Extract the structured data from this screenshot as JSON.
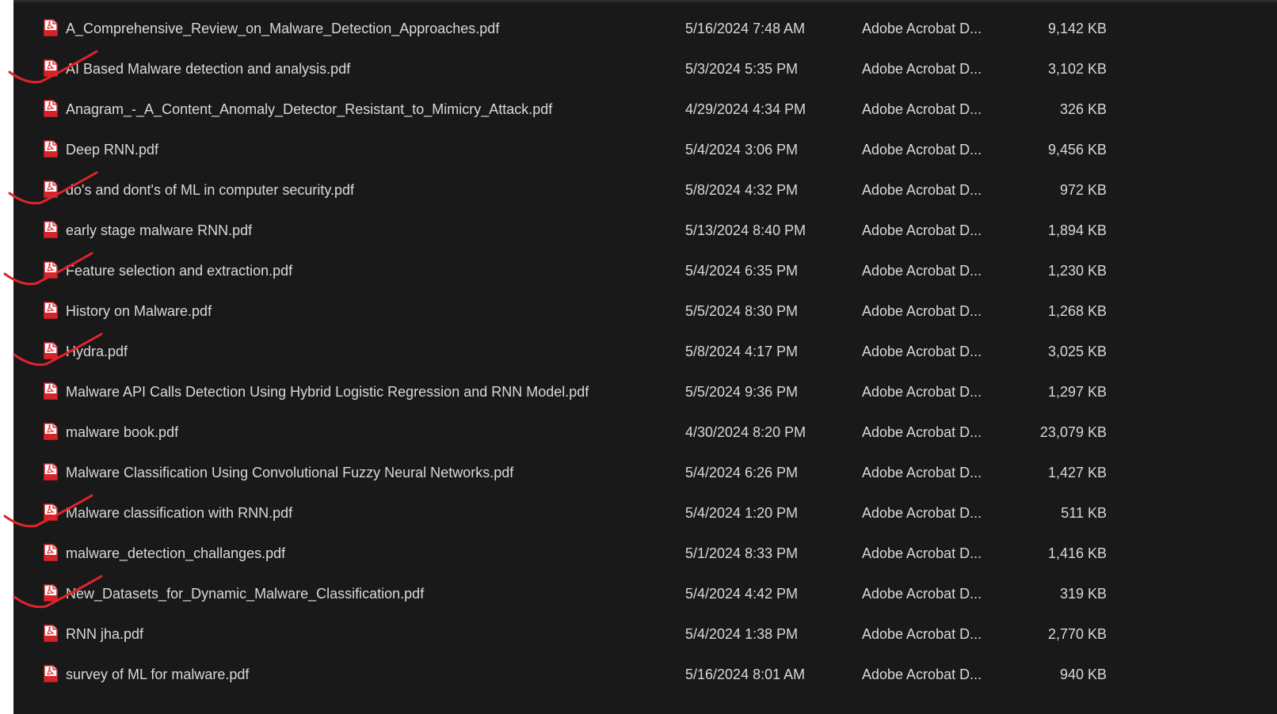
{
  "pdf_icon": "pdf-file-icon",
  "annotation_color": "#e0242b",
  "files": [
    {
      "name": "A_Comprehensive_Review_on_Malware_Detection_Approaches.pdf",
      "date": "5/16/2024 7:48 AM",
      "type": "Adobe Acrobat D...",
      "size": "9,142 KB",
      "checked": false
    },
    {
      "name": "AI Based Malware detection and analysis.pdf",
      "date": "5/3/2024 5:35 PM",
      "type": "Adobe Acrobat D...",
      "size": "3,102 KB",
      "checked": true
    },
    {
      "name": "Anagram_-_A_Content_Anomaly_Detector_Resistant_to_Mimicry_Attack.pdf",
      "date": "4/29/2024 4:34 PM",
      "type": "Adobe Acrobat D...",
      "size": "326 KB",
      "checked": false
    },
    {
      "name": "Deep RNN.pdf",
      "date": "5/4/2024 3:06 PM",
      "type": "Adobe Acrobat D...",
      "size": "9,456 KB",
      "checked": false
    },
    {
      "name": "do's and dont's of ML in computer security.pdf",
      "date": "5/8/2024 4:32 PM",
      "type": "Adobe Acrobat D...",
      "size": "972 KB",
      "checked": true
    },
    {
      "name": "early stage malware RNN.pdf",
      "date": "5/13/2024 8:40 PM",
      "type": "Adobe Acrobat D...",
      "size": "1,894 KB",
      "checked": false
    },
    {
      "name": "Feature selection and extraction.pdf",
      "date": "5/4/2024 6:35 PM",
      "type": "Adobe Acrobat D...",
      "size": "1,230 KB",
      "checked": true
    },
    {
      "name": "History on Malware.pdf",
      "date": "5/5/2024 8:30 PM",
      "type": "Adobe Acrobat D...",
      "size": "1,268 KB",
      "checked": false
    },
    {
      "name": "Hydra.pdf",
      "date": "5/8/2024 4:17 PM",
      "type": "Adobe Acrobat D...",
      "size": "3,025 KB",
      "checked": true
    },
    {
      "name": "Malware API Calls Detection Using Hybrid Logistic Regression and RNN Model.pdf",
      "date": "5/5/2024 9:36 PM",
      "type": "Adobe Acrobat D...",
      "size": "1,297 KB",
      "checked": false
    },
    {
      "name": "malware book.pdf",
      "date": "4/30/2024 8:20 PM",
      "type": "Adobe Acrobat D...",
      "size": "23,079 KB",
      "checked": false
    },
    {
      "name": "Malware Classification Using Convolutional Fuzzy Neural Networks.pdf",
      "date": "5/4/2024 6:26 PM",
      "type": "Adobe Acrobat D...",
      "size": "1,427 KB",
      "checked": false
    },
    {
      "name": "Malware classification with RNN.pdf",
      "date": "5/4/2024 1:20 PM",
      "type": "Adobe Acrobat D...",
      "size": "511 KB",
      "checked": true
    },
    {
      "name": "malware_detection_challanges.pdf",
      "date": "5/1/2024 8:33 PM",
      "type": "Adobe Acrobat D...",
      "size": "1,416 KB",
      "checked": false
    },
    {
      "name": "New_Datasets_for_Dynamic_Malware_Classification.pdf",
      "date": "5/4/2024 4:42 PM",
      "type": "Adobe Acrobat D...",
      "size": "319 KB",
      "checked": true
    },
    {
      "name": "RNN jha.pdf",
      "date": "5/4/2024 1:38 PM",
      "type": "Adobe Acrobat D...",
      "size": "2,770 KB",
      "checked": false
    },
    {
      "name": "survey of ML for malware.pdf",
      "date": "5/16/2024 8:01 AM",
      "type": "Adobe Acrobat D...",
      "size": "940 KB",
      "checked": false
    }
  ]
}
